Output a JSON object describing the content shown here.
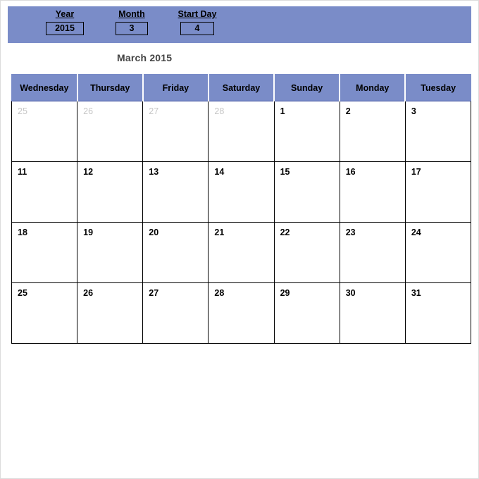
{
  "colors": {
    "accent": "#7a8cc8",
    "grid_line": "#000000",
    "outside_day_text": "#c6c6c6",
    "title_text": "#444444",
    "page_border": "#dcdcdc"
  },
  "controls": {
    "year": {
      "label": "Year",
      "value": "2015"
    },
    "month": {
      "label": "Month",
      "value": "3"
    },
    "start_day": {
      "label": "Start Day",
      "value": "4"
    }
  },
  "title": "March 2015",
  "calendar": {
    "day_headers": [
      "Wednesday",
      "Thursday",
      "Friday",
      "Saturday",
      "Sunday",
      "Monday",
      "Tuesday"
    ],
    "weeks": [
      [
        {
          "day": "25",
          "outside": true
        },
        {
          "day": "26",
          "outside": true
        },
        {
          "day": "27",
          "outside": true
        },
        {
          "day": "28",
          "outside": true
        },
        {
          "day": "1",
          "outside": false
        },
        {
          "day": "2",
          "outside": false
        },
        {
          "day": "3",
          "outside": false
        }
      ],
      [
        {
          "day": "11",
          "outside": false
        },
        {
          "day": "12",
          "outside": false
        },
        {
          "day": "13",
          "outside": false
        },
        {
          "day": "14",
          "outside": false
        },
        {
          "day": "15",
          "outside": false
        },
        {
          "day": "16",
          "outside": false
        },
        {
          "day": "17",
          "outside": false
        }
      ],
      [
        {
          "day": "18",
          "outside": false
        },
        {
          "day": "19",
          "outside": false
        },
        {
          "day": "20",
          "outside": false
        },
        {
          "day": "21",
          "outside": false
        },
        {
          "day": "22",
          "outside": false
        },
        {
          "day": "23",
          "outside": false
        },
        {
          "day": "24",
          "outside": false
        }
      ],
      [
        {
          "day": "25",
          "outside": false
        },
        {
          "day": "26",
          "outside": false
        },
        {
          "day": "27",
          "outside": false
        },
        {
          "day": "28",
          "outside": false
        },
        {
          "day": "29",
          "outside": false
        },
        {
          "day": "30",
          "outside": false
        },
        {
          "day": "31",
          "outside": false
        }
      ]
    ]
  }
}
